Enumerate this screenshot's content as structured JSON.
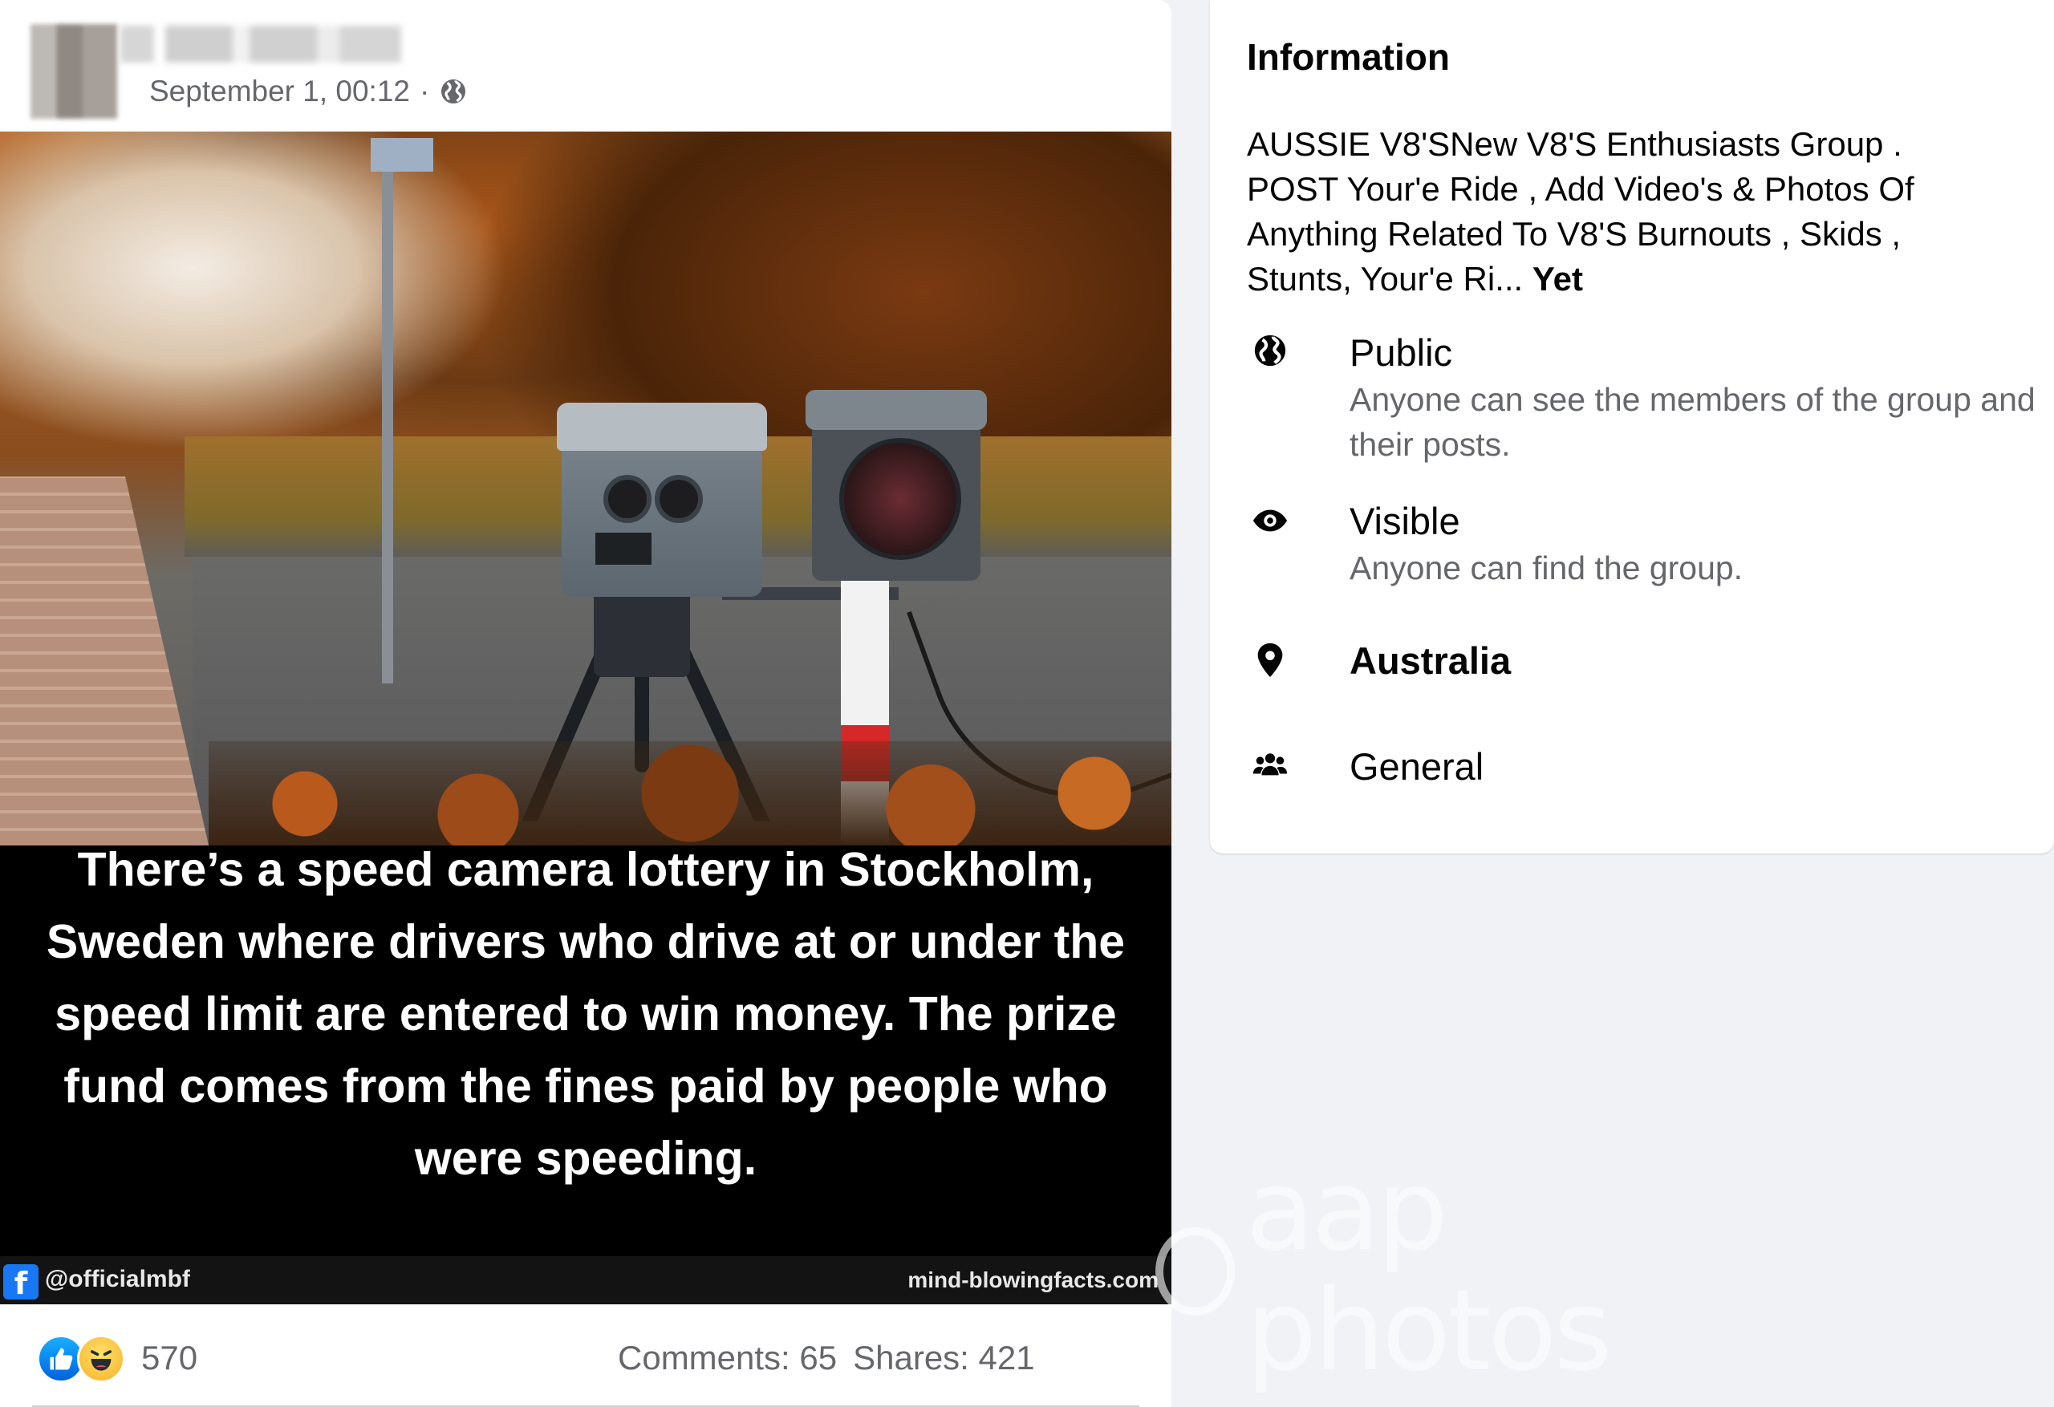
{
  "post": {
    "author_name": "",
    "timestamp": "September 1, 00:12",
    "separator": "·",
    "privacy_icon": "globe-icon",
    "image_caption": "There’s a speed camera lottery in Stockholm, Sweden where drivers who drive at or under the speed limit are entered to win money. The prize fund comes from the fines paid by people who were speeding.",
    "image_handle": "@officialmbf",
    "image_site": "mind-blowingfacts.com",
    "fb_glyph": "f",
    "reactions": {
      "icons": [
        "like-icon",
        "haha-icon"
      ],
      "count": "570",
      "comments": "Comments: 65",
      "shares": "Shares: 421"
    }
  },
  "info": {
    "title": "Information",
    "description": "AUSSIE V8'SNew V8'S Enthusiasts Group . POST Your'e Ride , Add Video's & Photos Of Anything Related To V8'S Burnouts , Skids , Stunts, Your'e Ri...",
    "see_more": "Yet",
    "public": {
      "label": "Public",
      "sub": "Anyone can see the members of the group and their posts.",
      "icon": "globe-icon"
    },
    "visible": {
      "label": "Visible",
      "sub": "Anyone can find the group.",
      "icon": "eye-icon"
    },
    "location": {
      "label": "Australia",
      "icon": "location-pin-icon"
    },
    "category": {
      "label": "General",
      "icon": "group-icon"
    }
  },
  "watermark": {
    "text": "aap photos"
  },
  "colors": {
    "page_bg": "#f0f2f5",
    "card_bg": "#ffffff",
    "secondary_text": "#65676b",
    "facebook_blue": "#1877f2"
  }
}
